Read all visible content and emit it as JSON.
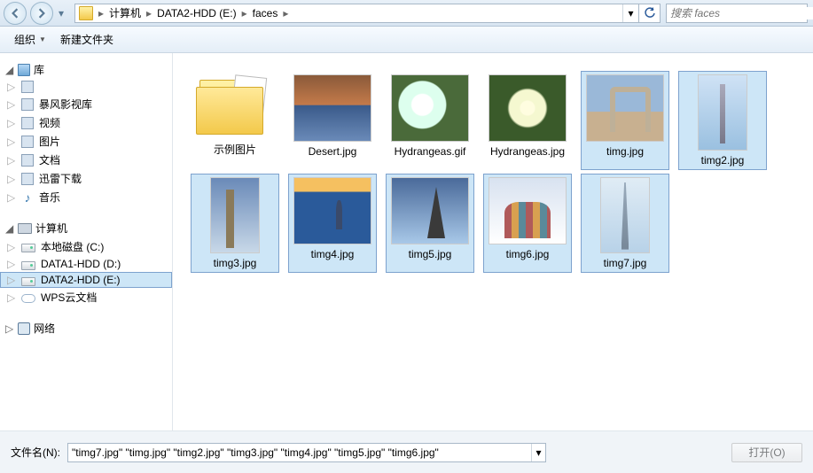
{
  "nav": {
    "breadcrumbs": [
      "计算机",
      "DATA2-HDD (E:)",
      "faces"
    ]
  },
  "search": {
    "placeholder": "搜索 faces"
  },
  "toolbar": {
    "organize": "组织",
    "new_folder": "新建文件夹"
  },
  "sidebar": {
    "libraries": {
      "label": "库",
      "items": [
        {
          "label": "暴风影视库",
          "icon": "media"
        },
        {
          "label": "视频",
          "icon": "video"
        },
        {
          "label": "图片",
          "icon": "pictures"
        },
        {
          "label": "文档",
          "icon": "documents"
        },
        {
          "label": "迅雷下载",
          "icon": "download"
        },
        {
          "label": "音乐",
          "icon": "music"
        }
      ],
      "extra_top": {
        "label": ""
      }
    },
    "computer": {
      "label": "计算机",
      "items": [
        {
          "label": "本地磁盘 (C:)",
          "icon": "drive"
        },
        {
          "label": "DATA1-HDD (D:)",
          "icon": "drive"
        },
        {
          "label": "DATA2-HDD (E:)",
          "icon": "drive",
          "selected": true
        },
        {
          "label": "WPS云文档",
          "icon": "cloud"
        }
      ]
    },
    "network": {
      "label": "网络"
    }
  },
  "files": [
    {
      "name": "示例图片",
      "type": "folder",
      "selected": false
    },
    {
      "name": "Desert.jpg",
      "type": "image",
      "thumb": "desert",
      "selected": false
    },
    {
      "name": "Hydrangeas.gif",
      "type": "image",
      "thumb": "flower",
      "selected": false
    },
    {
      "name": "Hydrangeas.jpg",
      "type": "image",
      "thumb": "flower2",
      "selected": false
    },
    {
      "name": "timg.jpg",
      "type": "image",
      "thumb": "arch",
      "selected": true
    },
    {
      "name": "timg2.jpg",
      "type": "image",
      "thumb": "tower",
      "portrait": true,
      "selected": true
    },
    {
      "name": "timg3.jpg",
      "type": "image",
      "thumb": "bigben",
      "portrait": true,
      "selected": true
    },
    {
      "name": "timg4.jpg",
      "type": "image",
      "thumb": "burj",
      "selected": true
    },
    {
      "name": "timg5.jpg",
      "type": "image",
      "thumb": "eiffel",
      "selected": true
    },
    {
      "name": "timg6.jpg",
      "type": "image",
      "thumb": "basils",
      "selected": true
    },
    {
      "name": "timg7.jpg",
      "type": "image",
      "thumb": "khalifa",
      "portrait": true,
      "selected": true
    }
  ],
  "bottom": {
    "label": "文件名(N):",
    "value": "\"timg7.jpg\" \"timg.jpg\" \"timg2.jpg\" \"timg3.jpg\" \"timg4.jpg\" \"timg5.jpg\" \"timg6.jpg\"",
    "open_btn": "打开(O)"
  }
}
